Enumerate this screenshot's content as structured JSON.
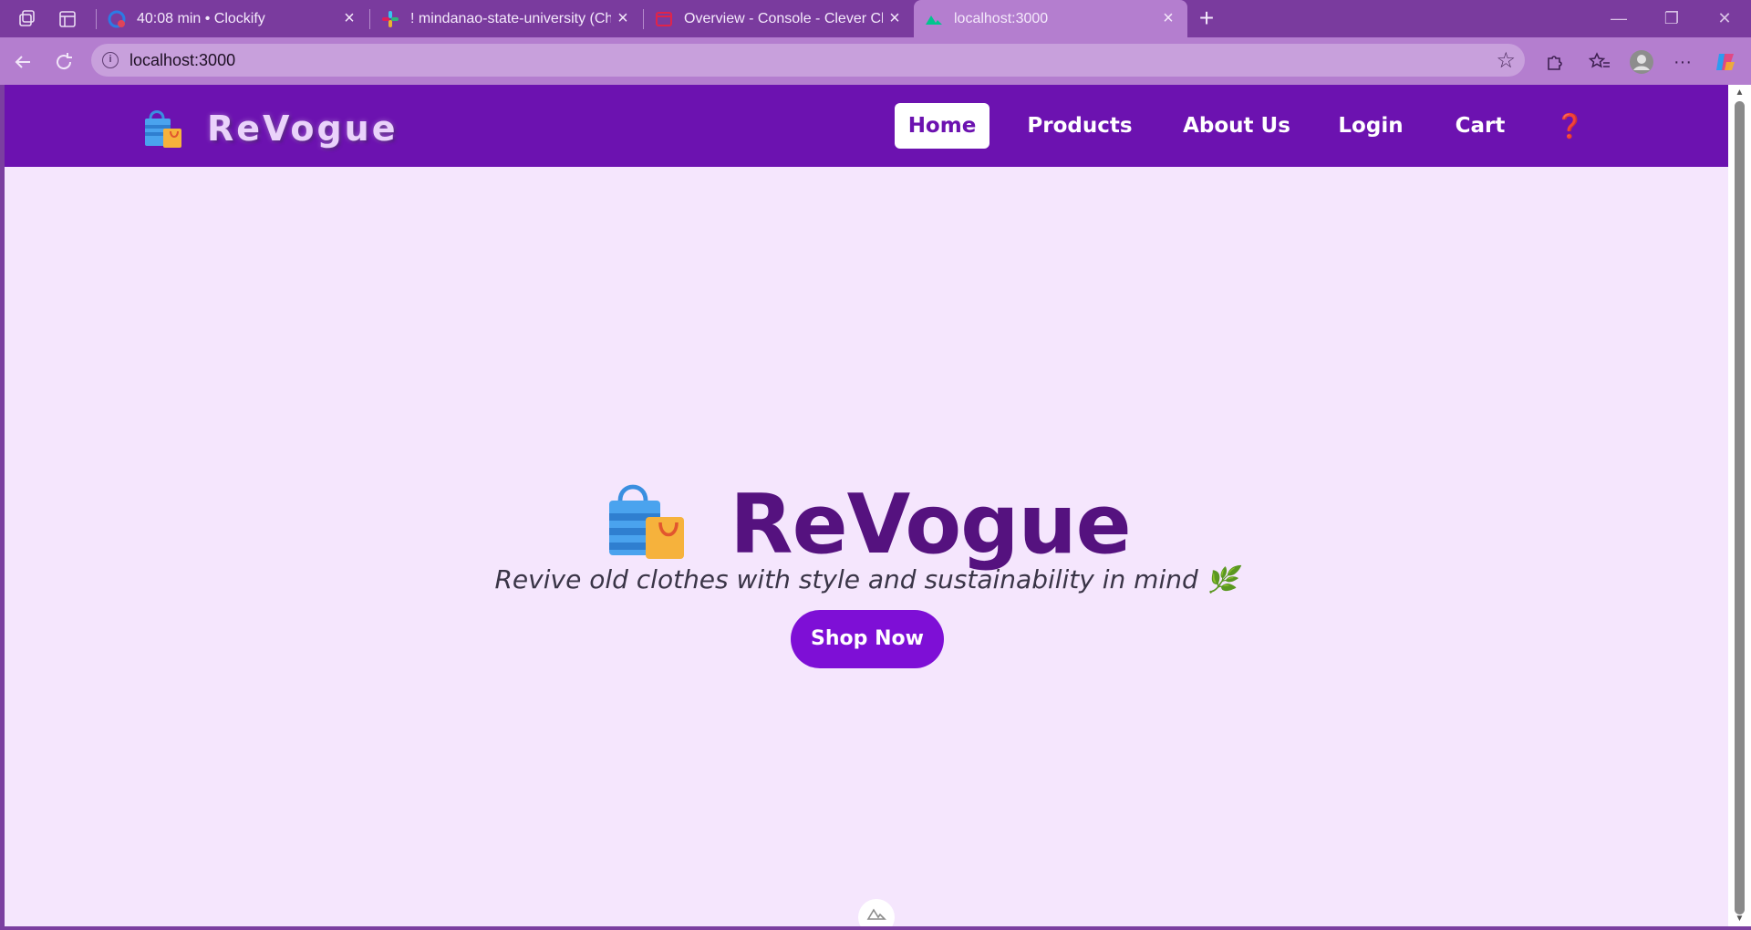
{
  "browser": {
    "tabs": [
      {
        "title": "40:08 min • Clockify",
        "favicon": "clockify-icon"
      },
      {
        "title": "! mindanao-state-university (Char",
        "favicon": "slack-icon"
      },
      {
        "title": "Overview - Console - Clever Cloud",
        "favicon": "clever-cloud-icon"
      },
      {
        "title": "localhost:3000",
        "favicon": "nuxt-icon",
        "active": true
      }
    ],
    "address": "localhost:3000"
  },
  "site": {
    "brand": "ReVogue",
    "nav": {
      "home": "Home",
      "products": "Products",
      "about": "About Us",
      "login": "Login",
      "cart": "Cart",
      "help": "❓"
    },
    "hero": {
      "title": "ReVogue",
      "tagline": "Revive old clothes with style and sustainability in mind 🌿",
      "cta": "Shop Now"
    }
  },
  "colors": {
    "navbar": "#6c12b0",
    "page_bg": "#f5e6fd",
    "title": "#55127f",
    "cta": "#7e0fd6"
  }
}
